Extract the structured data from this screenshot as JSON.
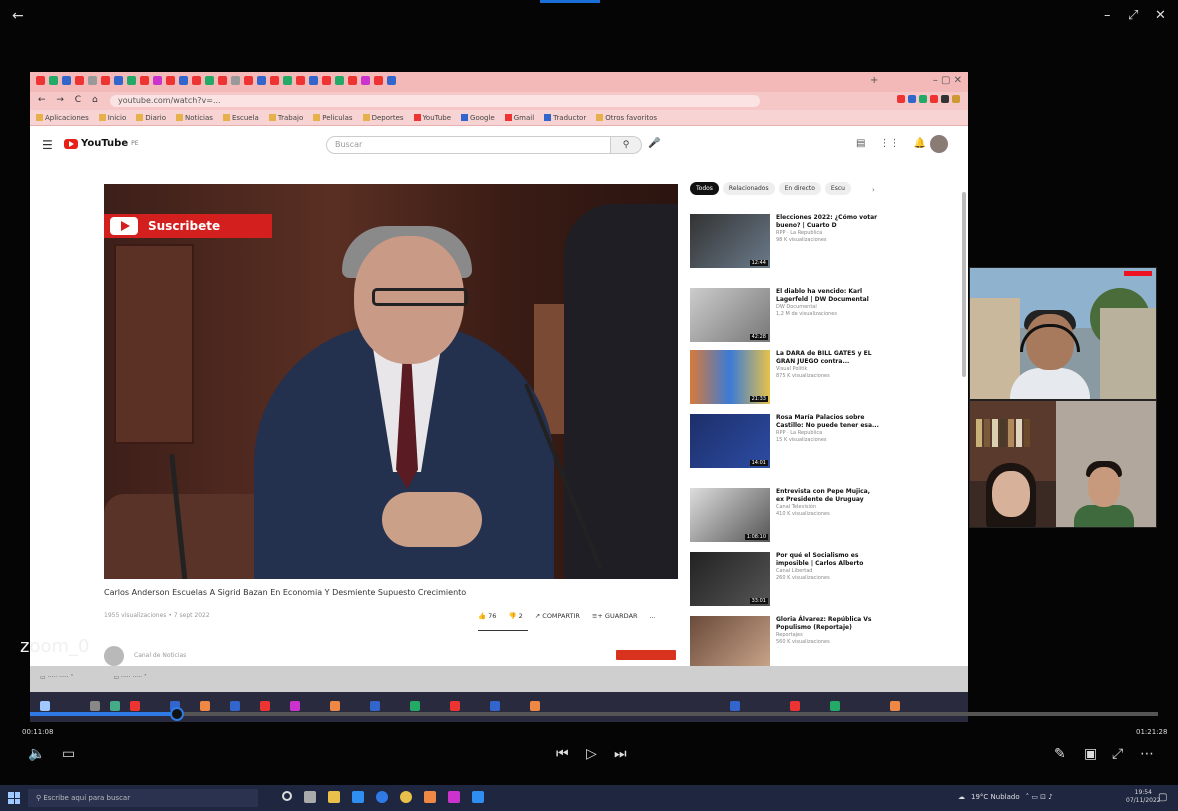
{
  "window": {
    "back": "←",
    "minimize": "–",
    "maximize": "⤢",
    "close": "✕"
  },
  "browser": {
    "url": "youtube.com/watch?v=...",
    "bookmarks": [
      "Aplicaciones",
      "Inicio",
      "Diario",
      "Noticias",
      "Escuela",
      "Trabajo",
      "Peliculas",
      "Deportes",
      "YouTube",
      "Google",
      "Gmail",
      "Traductor",
      "Otros favoritos"
    ]
  },
  "youtube": {
    "logo": "YouTube",
    "logo_sup": "PE",
    "search_placeholder": "Buscar",
    "subscribe_overlay": "Suscribete",
    "video_title": "Carlos Anderson Escuelas A Sigrid Bazan En Economia Y Desmiente Supuesto Crecimiento",
    "video_meta": "1955 visualizaciones  •  7 sept 2022",
    "actions": {
      "like": "76",
      "dislike": "2",
      "share": "COMPARTIR",
      "save": "GUARDAR",
      "more": "..."
    },
    "channel_name": "Canal de Noticias",
    "chips": [
      "Todos",
      "Relacionados",
      "En directo",
      "Escu"
    ],
    "recommendations": [
      {
        "title": "Elecciones 2022: ¿Cómo votar bueno? | Cuarto D",
        "channel": "RPP · La Republica",
        "views": "98 K visualizaciones",
        "duration": "12:44"
      },
      {
        "title": "El diablo ha vencido: Karl Lagerfeld | DW Documental",
        "channel": "DW Documental",
        "views": "1,2 M de visualizaciones",
        "duration": "42:28"
      },
      {
        "title": "La DARA de BILL GATES y EL GRAN JUEGO contra...",
        "channel": "Visual Politik",
        "views": "875 K visualizaciones",
        "duration": "21:33"
      },
      {
        "title": "Rosa María Palacios sobre Castillo: No puede tener esa...",
        "channel": "RPP · La Republica",
        "views": "15 K visualizaciones",
        "duration": "14:01"
      },
      {
        "title": "Entrevista con Pepe Mujica, ex Presidente de Uruguay",
        "channel": "Canal Televisión",
        "views": "410 K visualizaciones",
        "duration": "1:08:10"
      },
      {
        "title": "Por qué el Socialismo es imposible | Carlos Alberto",
        "channel": "Canal Libertad",
        "views": "260 K visualizaciones",
        "duration": "33:01"
      },
      {
        "title": "Gloria Álvarez: República Vs Populismo (Reportaje)",
        "channel": "Reportajes",
        "views": "560 K visualizaciones",
        "duration": ""
      }
    ]
  },
  "zoom": {
    "label": "zoom_0"
  },
  "player": {
    "current_time": "00:11:08",
    "total_time": "01:21:28",
    "progress_fraction": 0.13
  },
  "taskbar": {
    "search_placeholder": "Escribe aquí para buscar",
    "weather": "19°C Nublado",
    "time": "19:54",
    "date": "07/11/2022"
  }
}
